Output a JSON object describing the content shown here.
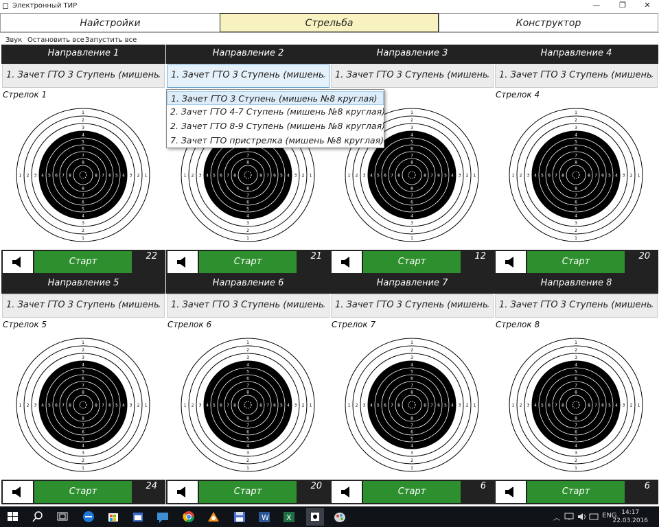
{
  "window": {
    "title": "Электронный ТИР"
  },
  "tabs": [
    {
      "label": "Найстройки"
    },
    {
      "label": "Стрельба"
    },
    {
      "label": "Конструктор"
    }
  ],
  "toolbar": {
    "sound": "Звук",
    "stop_all": "Остановить все",
    "start_all": "Запустить все"
  },
  "lanes": [
    {
      "header": "Направление 1",
      "exercise": "1. Зачет ГТО 3 Ступень (мишень",
      "shooter": "Стрелок 1",
      "start": "Старт",
      "count": "22"
    },
    {
      "header": "Направление 2",
      "exercise": "1. Зачет ГТО 3 Ступень (мишень",
      "shooter": "",
      "start": "Старт",
      "count": "21"
    },
    {
      "header": "Направление 3",
      "exercise": "1. Зачет ГТО 3 Ступень (мишень",
      "shooter": "",
      "start": "Старт",
      "count": "12"
    },
    {
      "header": "Направление 4",
      "exercise": "1. Зачет ГТО 3 Ступень (мишень",
      "shooter": "Стрелок 4",
      "start": "Старт",
      "count": "20"
    },
    {
      "header": "Направление 5",
      "exercise": "1. Зачет ГТО 3 Ступень (мишень",
      "shooter": "Стрелок 5",
      "start": "Старт",
      "count": "24"
    },
    {
      "header": "Направление 6",
      "exercise": "1. Зачет ГТО 3 Ступень (мишень",
      "shooter": "Стрелок 6",
      "start": "Старт",
      "count": "20"
    },
    {
      "header": "Направление 7",
      "exercise": "1. Зачет ГТО 3 Ступень (мишень",
      "shooter": "Стрелок 7",
      "start": "Старт",
      "count": "6"
    },
    {
      "header": "Направление 8",
      "exercise": "1. Зачет ГТО 3 Ступень (мишень",
      "shooter": "Стрелок 8",
      "start": "Старт",
      "count": "6"
    }
  ],
  "dropdown": {
    "options": [
      {
        "label": "1. Зачет ГТО 3 Ступень (мишень №8 круглая)"
      },
      {
        "label": "2. Зачет ГТО 4-7 Ступень (мишень №8 круглая)"
      },
      {
        "label": "2. Зачет ГТО 8-9 Ступень (мишень №8 круглая)"
      },
      {
        "label": "7. Зачет ГТО пристрелка (мишень №8 круглая)"
      }
    ]
  },
  "target": {
    "ring_numbers": [
      "1",
      "2",
      "3",
      "4",
      "5",
      "6",
      "7",
      "8"
    ]
  },
  "taskbar": {
    "lang": "ENG",
    "time": "14:17",
    "date": "22.03.2016"
  },
  "colors": {
    "header_bg": "#222222",
    "start_green": "#2e8f2e",
    "active_tab": "#f8f2c0"
  }
}
